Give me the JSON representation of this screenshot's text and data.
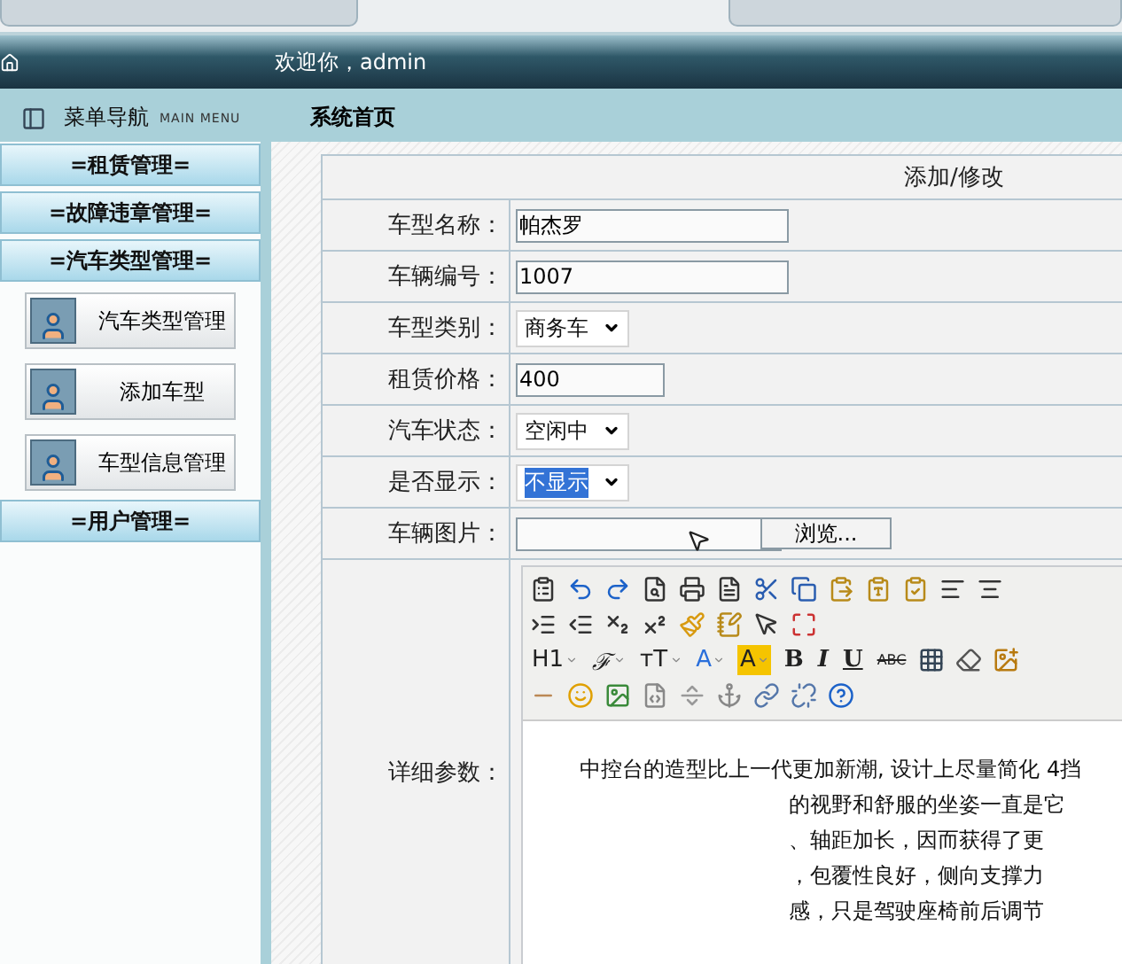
{
  "header": {
    "welcome": "欢迎你，admin"
  },
  "sidebar": {
    "title": "菜单导航",
    "subtitle": "MAIN MENU",
    "sections": [
      {
        "label": "=租赁管理="
      },
      {
        "label": "=故障违章管理="
      },
      {
        "label": "=汽车类型管理=",
        "items": [
          {
            "label": "汽车类型管理"
          },
          {
            "label": "添加车型"
          },
          {
            "label": "车型信息管理"
          }
        ]
      },
      {
        "label": "=用户管理="
      }
    ]
  },
  "page_title": "系统首页",
  "form": {
    "title": "添加/修改",
    "fields": [
      {
        "label": "车型名称：",
        "kind": "text",
        "value": "帕杰罗"
      },
      {
        "label": "车辆编号：",
        "kind": "text",
        "value": "1007"
      },
      {
        "label": "车型类别：",
        "kind": "select",
        "value": "商务车",
        "highlighted": false
      },
      {
        "label": "租赁价格：",
        "kind": "text",
        "value": "400"
      },
      {
        "label": "汽车状态：",
        "kind": "select",
        "value": "空闲中",
        "highlighted": false
      },
      {
        "label": "是否显示：",
        "kind": "select",
        "value": "不显示",
        "highlighted": true
      },
      {
        "label": "车辆图片：",
        "kind": "file",
        "button": "浏览..."
      }
    ],
    "editor": {
      "label": "详细参数：",
      "toolbar": [
        [
          {
            "kind": "icon"
          },
          {
            "kind": "icon"
          },
          {
            "kind": "icon"
          },
          {
            "kind": "icon"
          },
          {
            "kind": "icon"
          },
          {
            "kind": "icon"
          },
          {
            "kind": "icon"
          },
          {
            "kind": "icon"
          },
          {
            "kind": "icon"
          },
          {
            "kind": "icon"
          },
          {
            "kind": "icon"
          },
          {
            "kind": "icon"
          },
          {
            "kind": "icon"
          }
        ],
        [
          {
            "kind": "icon"
          },
          {
            "kind": "icon"
          },
          {
            "kind": "icon"
          },
          {
            "kind": "icon"
          },
          {
            "kind": "icon"
          },
          {
            "kind": "icon"
          },
          {
            "kind": "icon"
          },
          {
            "kind": "icon"
          }
        ],
        [
          {
            "kind": "text",
            "label": "H1",
            "dropdown": true
          },
          {
            "kind": "text",
            "label": "ℱ",
            "dropdown": true
          },
          {
            "kind": "text",
            "label": "тT",
            "dropdown": true
          },
          {
            "kind": "text",
            "label": "A",
            "dropdown": true
          },
          {
            "kind": "text",
            "label": "A",
            "dropdown": true
          },
          {
            "kind": "text",
            "label": "B",
            "dropdown": false
          },
          {
            "kind": "text",
            "label": "I",
            "dropdown": false
          },
          {
            "kind": "text",
            "label": "U",
            "dropdown": false
          },
          {
            "kind": "text",
            "label": "ABC",
            "dropdown": false
          },
          {
            "kind": "icon"
          },
          {
            "kind": "icon"
          },
          {
            "kind": "icon"
          }
        ],
        [
          {
            "kind": "icon"
          },
          {
            "kind": "icon"
          },
          {
            "kind": "icon"
          },
          {
            "kind": "icon"
          },
          {
            "kind": "icon"
          },
          {
            "kind": "icon"
          },
          {
            "kind": "icon"
          },
          {
            "kind": "icon"
          },
          {
            "kind": "icon"
          }
        ]
      ],
      "lines": [
        {
          "kind": "full",
          "text": "中控台的造型比上一代更加新潮, 设计上尽量简化 4挡"
        },
        {
          "kind": "fragment",
          "text": "的视野和舒服的坐姿一直是它"
        },
        {
          "kind": "fragment",
          "text": "、轴距加长，因而获得了更"
        },
        {
          "kind": "fragment",
          "text": "，包覆性良好，侧向支撑力"
        },
        {
          "kind": "fragment",
          "text": "感，只是驾驶座椅前后调节"
        }
      ]
    }
  }
}
